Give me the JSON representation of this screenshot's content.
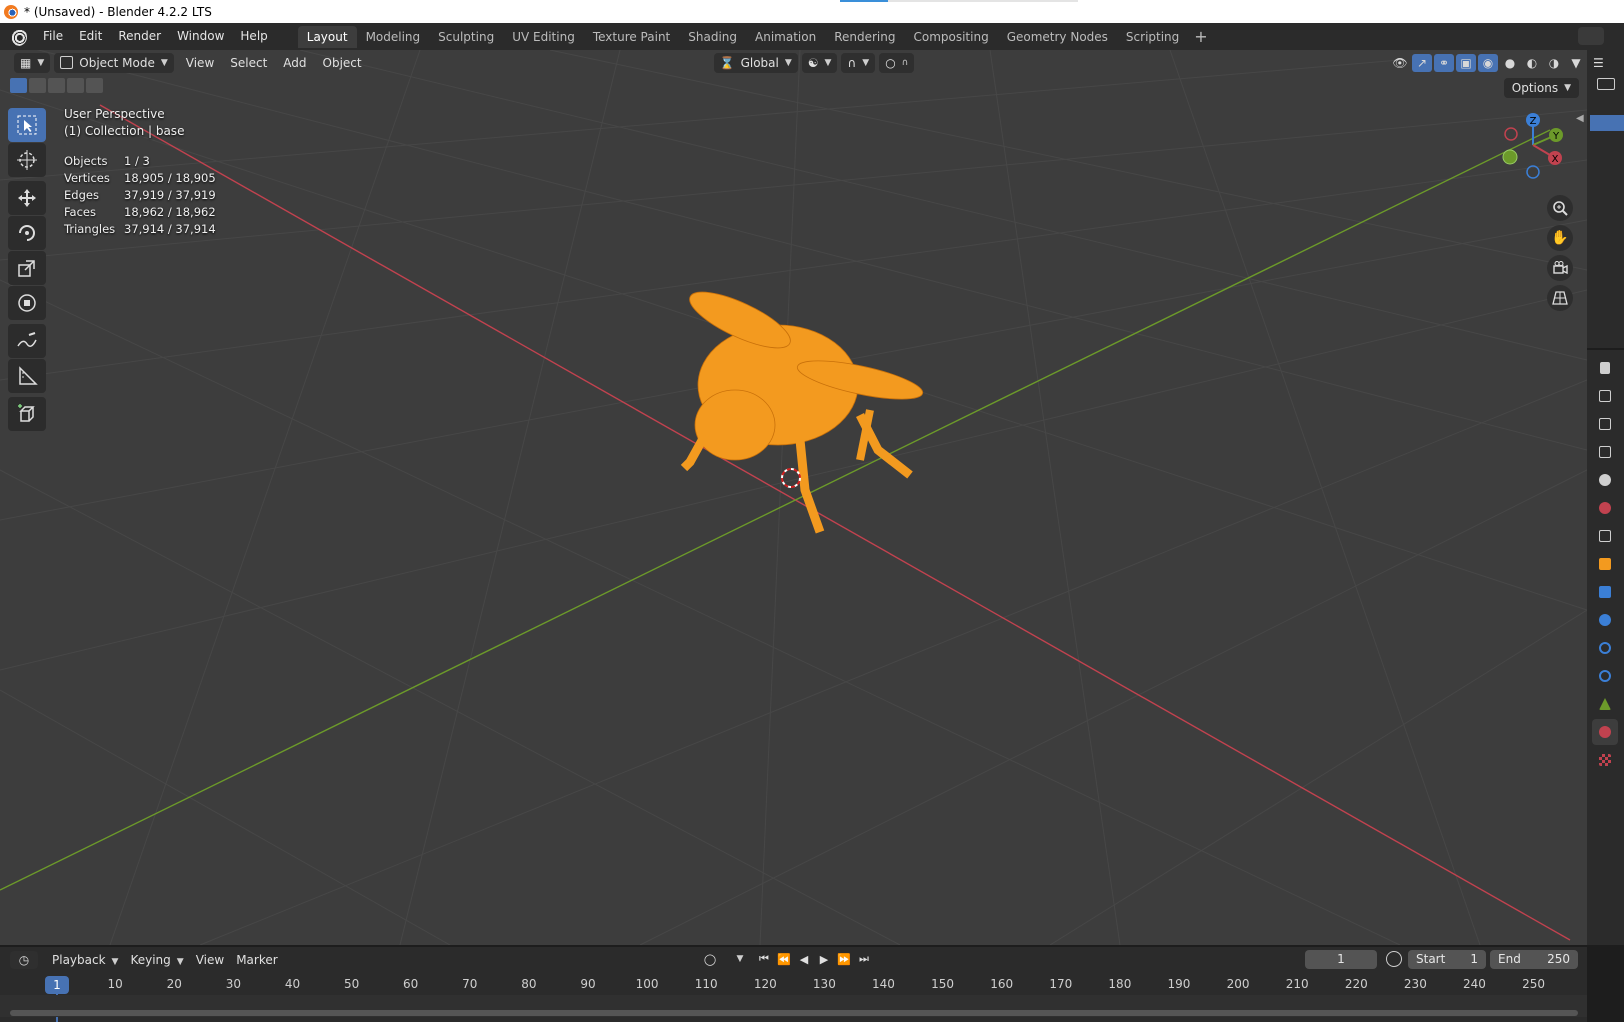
{
  "window": {
    "title": "* (Unsaved) - Blender 4.2.2 LTS"
  },
  "menu": {
    "items": [
      "File",
      "Edit",
      "Render",
      "Window",
      "Help"
    ]
  },
  "workspaces": {
    "tabs": [
      "Layout",
      "Modeling",
      "Sculpting",
      "UV Editing",
      "Texture Paint",
      "Shading",
      "Animation",
      "Rendering",
      "Compositing",
      "Geometry Nodes",
      "Scripting"
    ],
    "active": "Layout",
    "add_label": "+"
  },
  "viewport": {
    "mode": "Object Mode",
    "header_menus": [
      "View",
      "Select",
      "Add",
      "Object"
    ],
    "transform_orientation": "Global",
    "options_label": "Options",
    "perspective": "User Perspective",
    "collection": "(1) Collection | base",
    "stats": [
      {
        "key": "Objects",
        "value": "1 / 3"
      },
      {
        "key": "Vertices",
        "value": "18,905 / 18,905"
      },
      {
        "key": "Edges",
        "value": "37,919 / 37,919"
      },
      {
        "key": "Faces",
        "value": "18,962 / 18,962"
      },
      {
        "key": "Triangles",
        "value": "37,914 / 37,914"
      }
    ],
    "gizmo": {
      "x": "X",
      "y": "Y",
      "z": "Z"
    },
    "colors": {
      "background": "#3d3d3d",
      "selection": "#f39a1f",
      "x_axis": "#c1424f",
      "y_axis": "#6c9a2a",
      "z_axis": "#3b7fd6",
      "accent": "#4772b3"
    }
  },
  "toolbar": {
    "tools": [
      "select-box-icon",
      "cursor-icon",
      "move-icon",
      "rotate-icon",
      "scale-icon",
      "transform-icon",
      "annotate-icon",
      "measure-icon",
      "add-cube-icon"
    ]
  },
  "timeline": {
    "menus": [
      "Playback",
      "Keying",
      "View",
      "Marker"
    ],
    "current_frame": "1",
    "start_label": "Start",
    "start": "1",
    "end_label": "End",
    "end": "250",
    "ruler_marks": [
      "10",
      "20",
      "30",
      "40",
      "50",
      "60",
      "70",
      "80",
      "90",
      "100",
      "110",
      "120",
      "130",
      "140",
      "150",
      "160",
      "170",
      "180",
      "190",
      "200",
      "210",
      "220",
      "230",
      "240",
      "250"
    ],
    "cursor_frame": "1"
  }
}
